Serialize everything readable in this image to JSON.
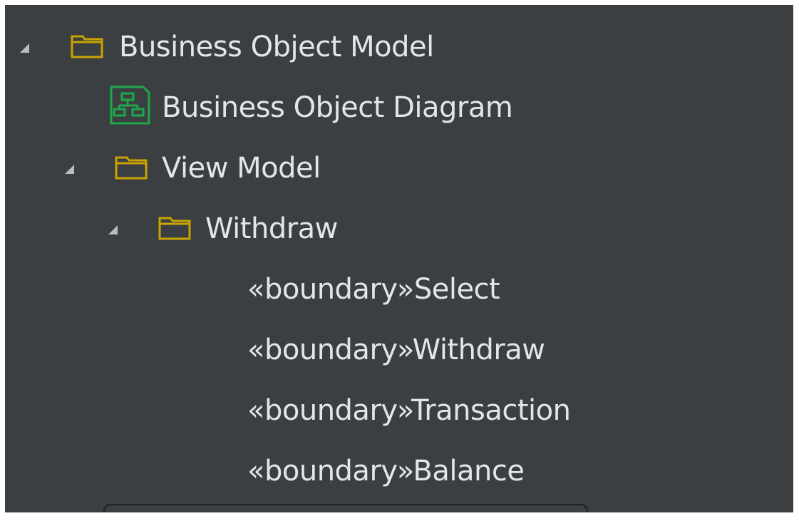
{
  "tree": {
    "root": {
      "label": "Business Object Model",
      "icon": "folder-icon",
      "expanded": true
    },
    "diagram": {
      "label": "Business Object Diagram",
      "icon": "diagram-icon"
    },
    "view_model": {
      "label": "View Model",
      "icon": "folder-icon",
      "expanded": true
    },
    "withdraw_folder": {
      "label": "Withdraw",
      "icon": "folder-icon",
      "expanded": true
    },
    "items": [
      {
        "label": "«boundary»Select"
      },
      {
        "label": "«boundary»Withdraw"
      },
      {
        "label": "«boundary»Transaction"
      },
      {
        "label": "«boundary»Balance"
      }
    ]
  },
  "colors": {
    "background": "#3b3f42",
    "text": "#e3e6e8",
    "folder": "#c9a400",
    "diagram": "#1fa84a",
    "arrow": "#b8bcbf"
  }
}
